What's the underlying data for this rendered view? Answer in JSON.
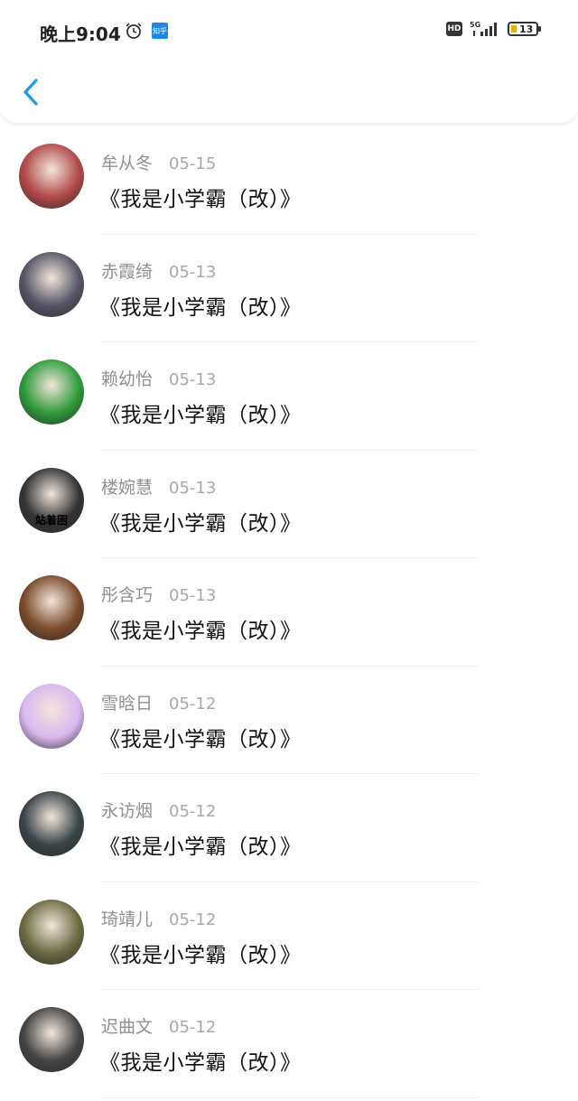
{
  "status_bar": {
    "time": "晚上9:04",
    "app_badge": "知乎",
    "hd": "HD",
    "network": "5G",
    "battery": "13"
  },
  "comments": [
    {
      "name": "牟从冬",
      "date": "05-15",
      "text": "《我是小学霸（改）》",
      "avatar_color": "#b04848"
    },
    {
      "name": "赤霞绮",
      "date": "05-13",
      "text": "《我是小学霸（改）》",
      "avatar_color": "#555566"
    },
    {
      "name": "赖幼怡",
      "date": "05-13",
      "text": "《我是小学霸（改）》",
      "avatar_color": "#2e9a3a"
    },
    {
      "name": "楼婉慧",
      "date": "05-13",
      "text": "《我是小学霸（改）》",
      "avatar_color": "#333333",
      "avatar_caption": "站着困"
    },
    {
      "name": "彤含巧",
      "date": "05-13",
      "text": "《我是小学霸（改）》",
      "avatar_color": "#7a4a2a"
    },
    {
      "name": "雪晗日",
      "date": "05-12",
      "text": "《我是小学霸（改）》",
      "avatar_color": "#d8b8f0"
    },
    {
      "name": "永访烟",
      "date": "05-12",
      "text": "《我是小学霸（改）》",
      "avatar_color": "#3a4448"
    },
    {
      "name": "琦靖儿",
      "date": "05-12",
      "text": "《我是小学霸（改）》",
      "avatar_color": "#6a6a40"
    },
    {
      "name": "迟曲文",
      "date": "05-12",
      "text": "《我是小学霸（改）》",
      "avatar_color": "#444444"
    }
  ]
}
